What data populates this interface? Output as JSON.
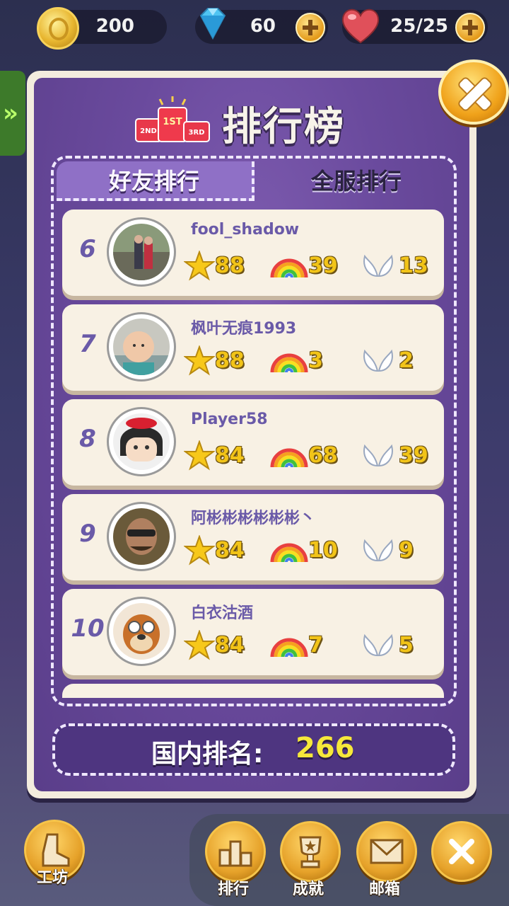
{
  "resources": {
    "coins": "200",
    "gems": "60",
    "lives": "25/25"
  },
  "panel": {
    "title": "排行榜",
    "podium": {
      "first": "1ST",
      "second": "2ND",
      "third": "3RD"
    }
  },
  "tabs": {
    "friends": "好友排行",
    "server": "全服排行",
    "active": "friends"
  },
  "leaderboard": [
    {
      "rank": "6",
      "name": "fool_shadow",
      "stars": "88",
      "rainbows": "39",
      "wings": "13"
    },
    {
      "rank": "7",
      "name": "枫叶无痕1993",
      "stars": "88",
      "rainbows": "3",
      "wings": "2"
    },
    {
      "rank": "8",
      "name": "Player58",
      "stars": "84",
      "rainbows": "68",
      "wings": "39"
    },
    {
      "rank": "9",
      "name": "阿彬彬彬彬彬彬丶",
      "stars": "84",
      "rainbows": "10",
      "wings": "9"
    },
    {
      "rank": "10",
      "name": "白衣沽酒",
      "stars": "84",
      "rainbows": "7",
      "wings": "5"
    }
  ],
  "national_rank": {
    "label": "国内排名:",
    "value": "266"
  },
  "bottom_nav": {
    "workshop": "工坊",
    "ranking": "排行",
    "achievements": "成就",
    "mailbox": "邮箱"
  },
  "colors": {
    "panel_purple": "#6a4a9d",
    "accent_orange": "#f0a21a",
    "name_purple": "#6a5aa8",
    "star_yellow": "#f2c418"
  }
}
